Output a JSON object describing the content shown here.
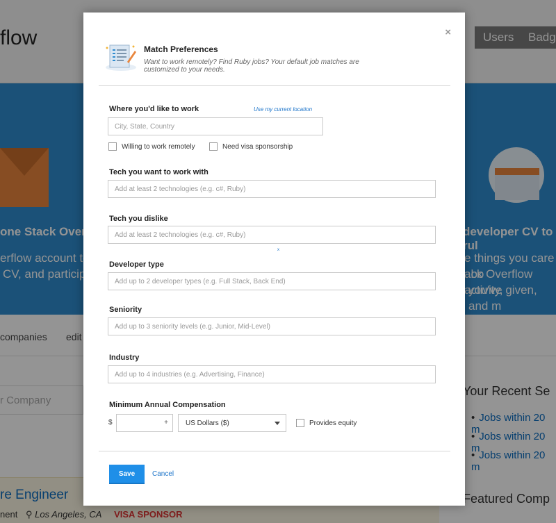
{
  "background": {
    "logo_text": "flow",
    "nav": [
      "Users",
      "Badge"
    ],
    "hero_left_title": "one Stack Overflo",
    "hero_left_lines": [
      "erflow account to r",
      "CV, and participat"
    ],
    "hero_right_title": "developer CV to rul",
    "hero_right_lines": [
      "e things you care abo",
      "ack Overflow activity,",
      "you've given, and m"
    ],
    "tabs": [
      "companies",
      "edit"
    ],
    "company_placeholder": "r Company",
    "recent_heading": "Your Recent Se",
    "recent_links": [
      "Jobs within 20 m",
      "Jobs within 20 m",
      "Jobs within 20 m"
    ],
    "featured_heading": "Featured Comp",
    "job_title": "re Engineer",
    "job_meta_left": "nent",
    "job_location": "Los Angeles, CA",
    "job_badge": "VISA SPONSOR"
  },
  "modal": {
    "close_glyph": "×",
    "title": "Match Preferences",
    "subtitle": "Want to work remotely? Find Ruby jobs? Your default job matches are customized to your needs.",
    "location": {
      "label": "Where you'd like to work",
      "link": "Use my current location",
      "placeholder": "City, State, Country",
      "remote_label": "Willing to work remotely",
      "visa_label": "Need visa sponsorship"
    },
    "tech_like": {
      "label": "Tech you want to work with",
      "placeholder": "Add at least 2 technologies (e.g. c#, Ruby)"
    },
    "tech_dislike": {
      "label": "Tech you dislike",
      "placeholder": "Add at least 2 technologies (e.g. c#, Ruby)"
    },
    "stray_mark": "x",
    "dev_type": {
      "label": "Developer type",
      "placeholder": "Add up to 2 developer types (e.g. Full Stack, Back End)"
    },
    "seniority": {
      "label": "Seniority",
      "placeholder": "Add up to 3 seniority levels (e.g. Junior, Mid-Level)"
    },
    "industry": {
      "label": "Industry",
      "placeholder": "Add up to 4 industries (e.g. Advertising, Finance)"
    },
    "compensation": {
      "label": "Minimum Annual Compensation",
      "currency_symbol": "$",
      "plus": "+",
      "currency": "US Dollars ($)",
      "equity_label": "Provides equity"
    },
    "save_label": "Save",
    "cancel_label": "Cancel"
  },
  "colors": {
    "accent": "#1f8fe8",
    "link": "#1a73c9",
    "hero": "#2f8ccf"
  }
}
